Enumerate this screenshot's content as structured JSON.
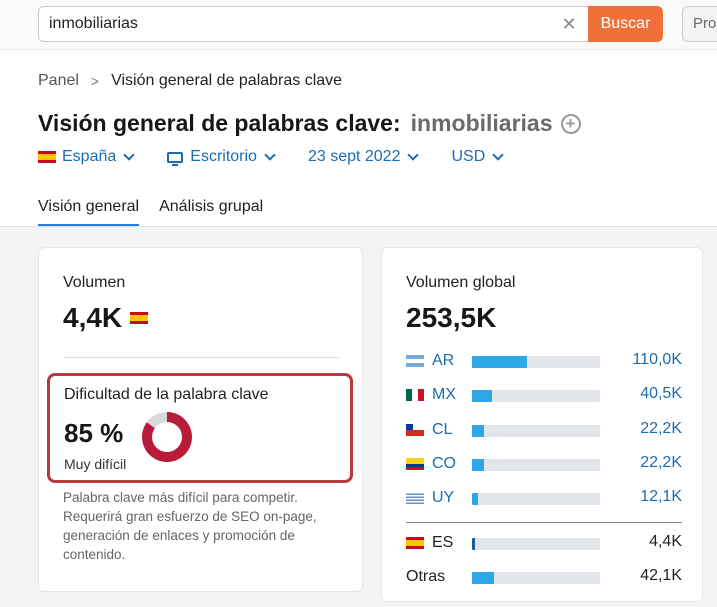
{
  "search": {
    "value": "inmobiliarias",
    "clear_icon": "close-icon",
    "button": "Buscar",
    "pro_label": "Pro"
  },
  "breadcrumb": {
    "root": "Panel",
    "current": "Visión general de palabras clave"
  },
  "title": {
    "text": "Visión general de palabras clave:",
    "keyword": "inmobiliarias"
  },
  "filters": {
    "country": "España",
    "device": "Escritorio",
    "date": "23 sept 2022",
    "currency": "USD"
  },
  "tabs": [
    {
      "label": "Visión general",
      "active": true
    },
    {
      "label": "Análisis grupal",
      "active": false
    }
  ],
  "volume": {
    "label": "Volumen",
    "value": "4,4K"
  },
  "difficulty": {
    "label": "Dificultad de la palabra clave",
    "value": "85 %",
    "level": "Muy difícil",
    "percent": 85,
    "description": "Palabra clave más difícil para competir. Requerirá gran esfuerzo de SEO on-page, generación de enlaces y promoción de contenido."
  },
  "global_volume": {
    "label": "Volumen global",
    "value": "253,5K",
    "countries": [
      {
        "code": "AR",
        "value": "110,0K",
        "fraction": 0.43
      },
      {
        "code": "MX",
        "value": "40,5K",
        "fraction": 0.16
      },
      {
        "code": "CL",
        "value": "22,2K",
        "fraction": 0.09
      },
      {
        "code": "CO",
        "value": "22,2K",
        "fraction": 0.09
      },
      {
        "code": "UY",
        "value": "12,1K",
        "fraction": 0.05
      }
    ],
    "local": {
      "code": "ES",
      "value": "4,4K",
      "fraction": 0.02
    },
    "other": {
      "label": "Otras",
      "value": "42,1K",
      "fraction": 0.17
    }
  },
  "colors": {
    "accent": "#f0703a",
    "link": "#1b6cb3",
    "bar": "#2ea7e8",
    "difficulty": "#b81c3a",
    "highlight_border": "#b9393e"
  }
}
